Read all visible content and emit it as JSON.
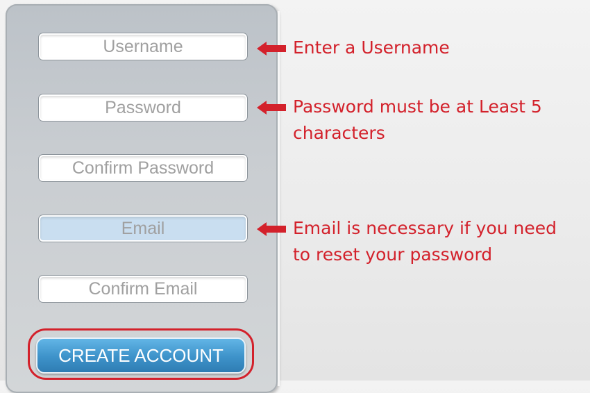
{
  "form": {
    "username_placeholder": "Username",
    "password_placeholder": "Password",
    "confirm_password_placeholder": "Confirm Password",
    "email_placeholder": "Email",
    "confirm_email_placeholder": "Confirm Email",
    "create_button_label": "CREATE ACCOUNT"
  },
  "annotations": {
    "username": "Enter a Username",
    "password": "Password must be at Least 5\ncharacters",
    "email": "Email is necessary if you need\nto reset your password"
  },
  "colors": {
    "annotation_red": "#d3212b",
    "button_blue": "#3d92c9",
    "active_field": "#c9def0"
  }
}
